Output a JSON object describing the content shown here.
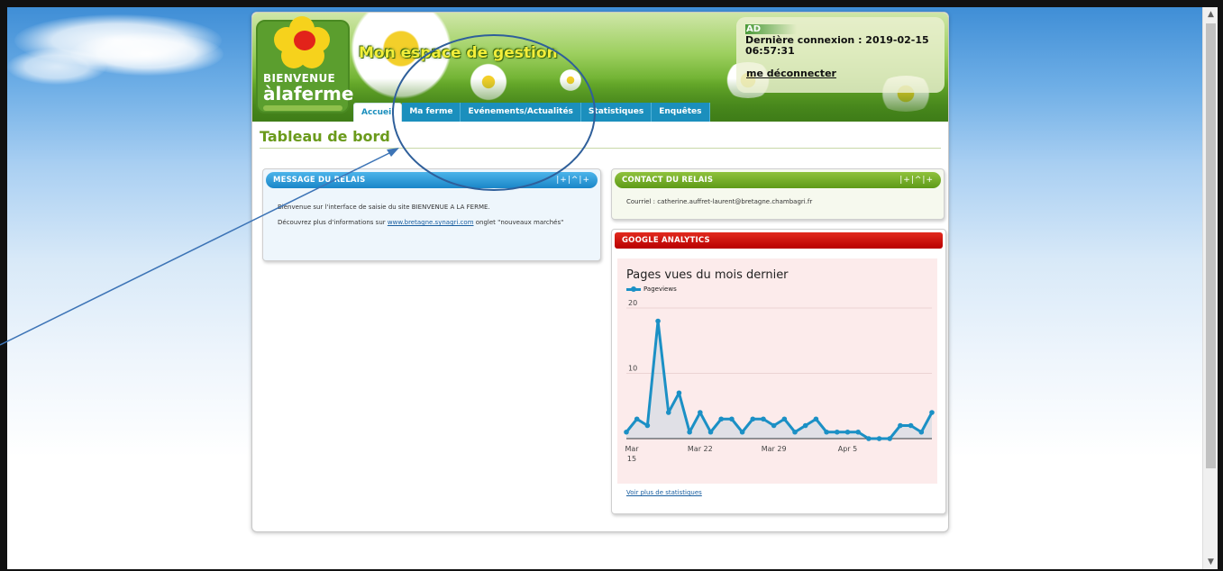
{
  "header": {
    "site_title": "Mon espace de gestion",
    "logo": {
      "line1": "BIENVENUE",
      "line2": "àlaferme"
    },
    "user": {
      "name": "AD",
      "last_login": "Dernière connexion : 2019-02-15 06:57:31",
      "logout": "me déconnecter"
    }
  },
  "nav": {
    "tabs": [
      {
        "label": "Accueil",
        "active": true
      },
      {
        "label": "Ma ferme",
        "active": false
      },
      {
        "label": "Evénements/Actualités",
        "active": false
      },
      {
        "label": "Statistiques",
        "active": false
      },
      {
        "label": "Enquêtes",
        "active": false
      }
    ]
  },
  "main": {
    "title": "Tableau de bord",
    "box_tools": "|+|^|+",
    "message_box": {
      "title": "MESSAGE DU RELAIS",
      "line1": "Bienvenue sur l'interface de saisie du site BIENVENUE A LA FERME.",
      "line2_prefix": "Découvrez plus d'informations sur ",
      "line2_link": "www.bretagne.synagri.com",
      "line2_suffix": " onglet \"nouveaux marchés\""
    },
    "contact_box": {
      "title": "CONTACT DU RELAIS",
      "email_line": "Courriel : catherine.auffret-laurent@bretagne.chambagri.fr"
    },
    "analytics_box": {
      "title": "GOOGLE ANALYTICS",
      "more_link": "Voir plus de statistiques"
    }
  },
  "colors": {
    "blue_header": "#1b8fd0",
    "green_header": "#6aa51e",
    "red_header": "#c40000",
    "series": "#1b90c5"
  },
  "chart_data": {
    "type": "area",
    "title": "Pages vues du mois dernier",
    "series": [
      {
        "name": "Pageviews",
        "values": [
          1,
          3,
          2,
          18,
          4,
          7,
          1,
          4,
          1,
          3,
          3,
          1,
          3,
          3,
          2,
          3,
          1,
          2,
          3,
          1,
          1,
          1,
          1,
          0,
          0,
          0,
          2,
          2,
          1,
          4
        ]
      }
    ],
    "x_tick_labels": [
      {
        "index": 0,
        "label": "Mar",
        "sub": "15"
      },
      {
        "index": 7,
        "label": "Mar 22",
        "sub": ""
      },
      {
        "index": 14,
        "label": "Mar 29",
        "sub": ""
      },
      {
        "index": 21,
        "label": "Apr 5",
        "sub": ""
      }
    ],
    "y_ticks": [
      10,
      20
    ],
    "ylim": [
      0,
      20
    ],
    "grid": true,
    "legend": "top-left"
  }
}
